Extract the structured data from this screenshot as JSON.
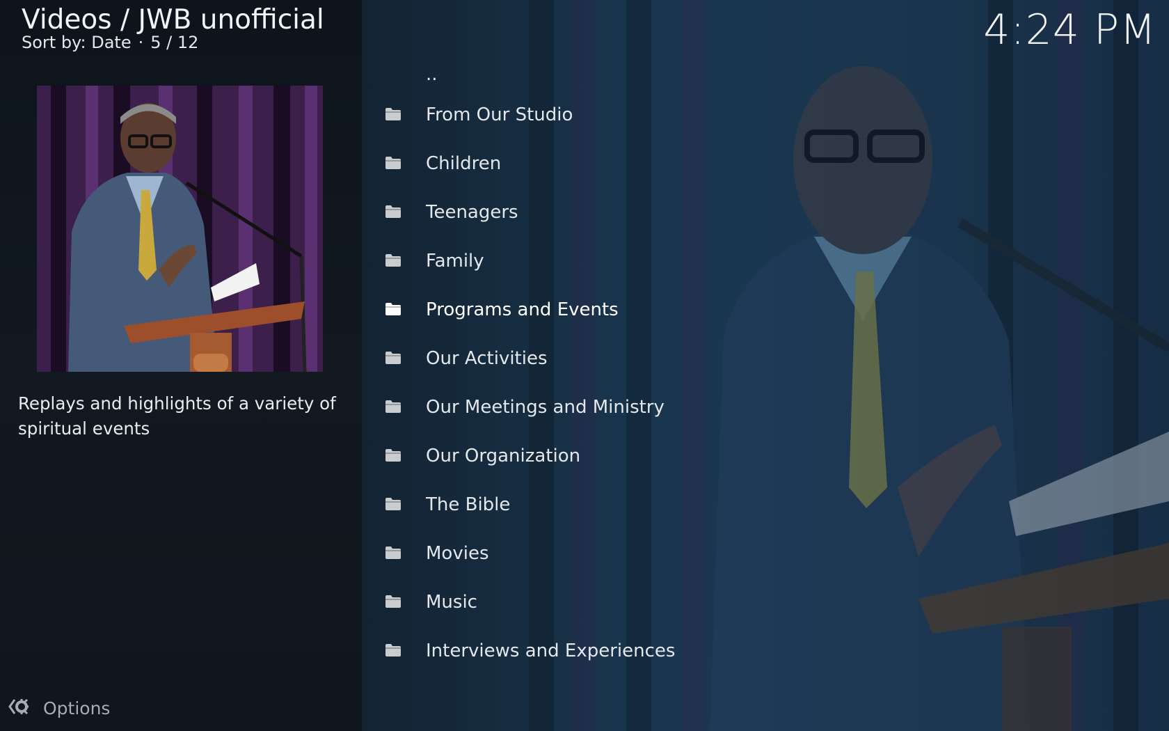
{
  "header": {
    "title": "Videos / JWB unofficial",
    "sort_label": "Sort by: Date",
    "separator": "·",
    "position": "5 / 12"
  },
  "clock": "4:24 PM",
  "info": {
    "plot": "Replays and highlights of a variety of spiritual events"
  },
  "list": {
    "parent": "..",
    "selected_index": 4,
    "items": [
      {
        "label": "From Our Studio",
        "icon": "folder-icon"
      },
      {
        "label": "Children",
        "icon": "folder-icon"
      },
      {
        "label": "Teenagers",
        "icon": "folder-icon"
      },
      {
        "label": "Family",
        "icon": "folder-icon"
      },
      {
        "label": "Programs and Events",
        "icon": "folder-icon"
      },
      {
        "label": "Our Activities",
        "icon": "folder-icon"
      },
      {
        "label": "Our Meetings and Ministry",
        "icon": "folder-icon"
      },
      {
        "label": "Our Organization",
        "icon": "folder-icon"
      },
      {
        "label": "The Bible",
        "icon": "folder-icon"
      },
      {
        "label": "Movies",
        "icon": "folder-icon"
      },
      {
        "label": "Music",
        "icon": "folder-icon"
      },
      {
        "label": "Interviews and Experiences",
        "icon": "folder-icon"
      }
    ]
  },
  "footer": {
    "options_label": "Options",
    "options_icon": "options-gear-icon"
  },
  "colors": {
    "panel": "#0d141c",
    "text": "#e4e8eb",
    "muted": "#a6adb3",
    "folder": "#c9cdd0",
    "folder_focus": "#ffffff"
  }
}
